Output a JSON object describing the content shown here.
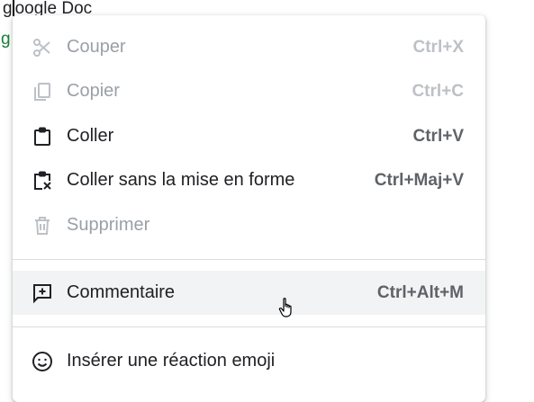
{
  "document": {
    "line1": "google Doc",
    "line2_fragment": "g"
  },
  "context_menu": {
    "items": [
      {
        "label": "Couper",
        "shortcut": "Ctrl+X",
        "icon": "scissors-icon",
        "enabled": false
      },
      {
        "label": "Copier",
        "shortcut": "Ctrl+C",
        "icon": "copy-icon",
        "enabled": false
      },
      {
        "label": "Coller",
        "shortcut": "Ctrl+V",
        "icon": "clipboard-icon",
        "enabled": true
      },
      {
        "label": "Coller sans la mise en forme",
        "shortcut": "Ctrl+Maj+V",
        "icon": "paste-no-format-icon",
        "enabled": true
      },
      {
        "label": "Supprimer",
        "shortcut": "",
        "icon": "trash-icon",
        "enabled": false
      },
      {
        "label": "Commentaire",
        "shortcut": "Ctrl+Alt+M",
        "icon": "add-comment-icon",
        "enabled": true,
        "hovered": true
      },
      {
        "label": "Insérer une réaction emoji",
        "shortcut": "",
        "icon": "emoji-icon",
        "enabled": true
      }
    ]
  },
  "colors": {
    "text": "#202124",
    "disabled_text": "#9aa0a6",
    "hover_bg": "#f1f3f4",
    "divider": "#dadce0"
  }
}
